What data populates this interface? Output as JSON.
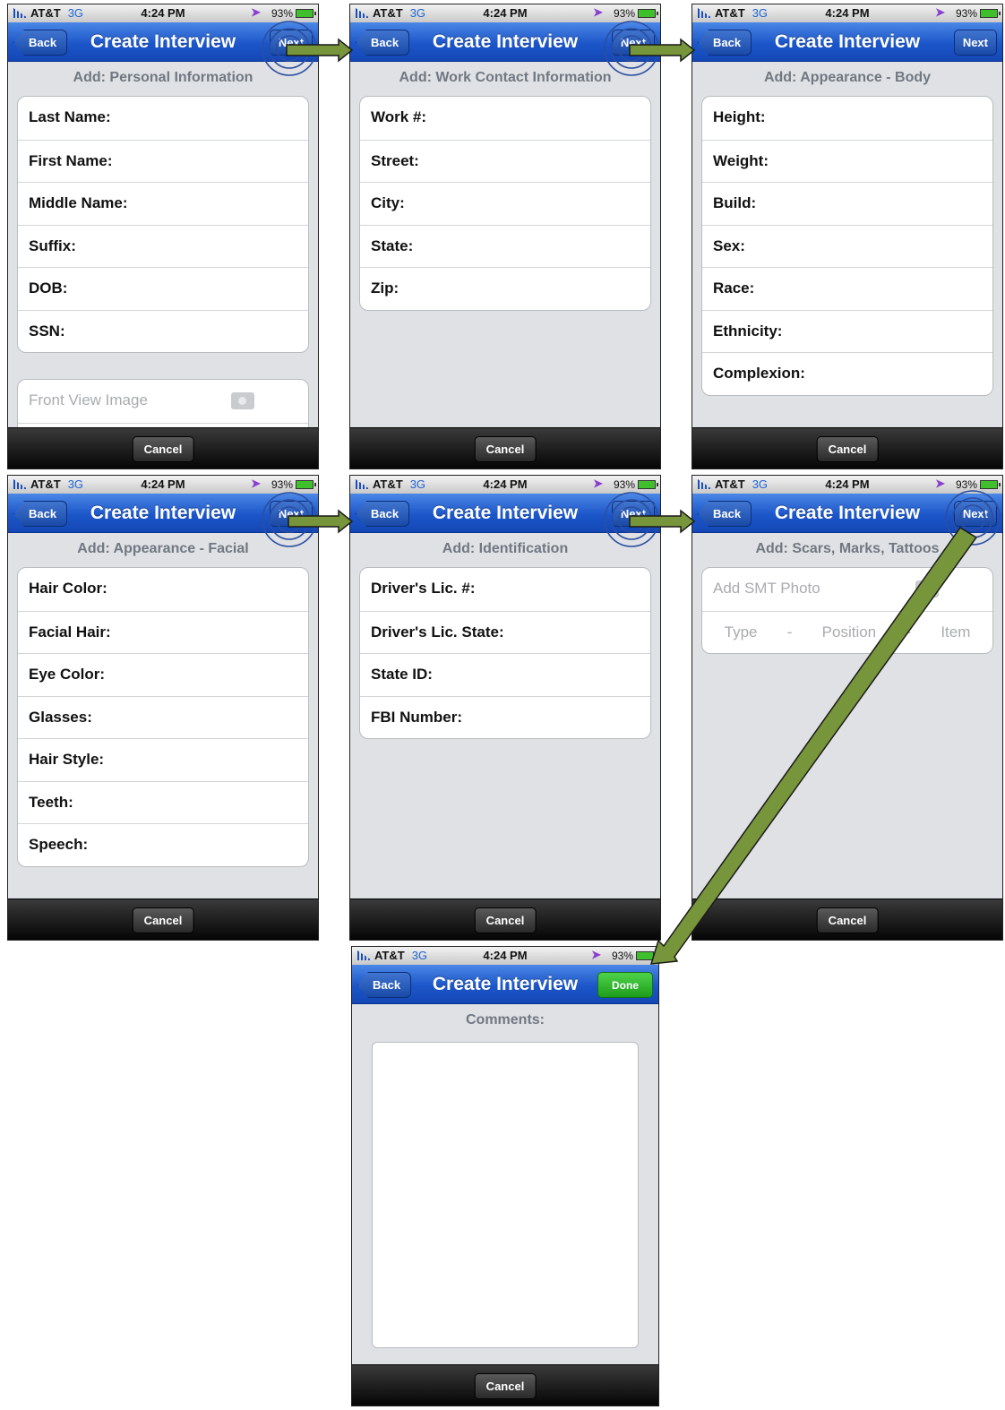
{
  "status": {
    "carrier": "AT&T",
    "network": "3G",
    "time": "4:24 PM",
    "battery": "93%",
    "location_icon": "location-arrow-icon"
  },
  "nav": {
    "title": "Create Interview",
    "back_label": "Back",
    "next_label": "Next",
    "done_label": "Done"
  },
  "toolbar": {
    "cancel_label": "Cancel"
  },
  "screens": [
    {
      "section": "Add: Personal Information",
      "rows": [
        "Last Name:",
        "First Name:",
        "Middle Name:",
        "Suffix:",
        "DOB:",
        "SSN:"
      ],
      "photo_placeholder": "Front View Image"
    },
    {
      "section": "Add: Work Contact Information",
      "rows": [
        "Work #:",
        "Street:",
        "City:",
        "State:",
        "Zip:"
      ]
    },
    {
      "section": "Add: Appearance - Body",
      "rows": [
        "Height:",
        "Weight:",
        "Build:",
        "Sex:",
        "Race:",
        "Ethnicity:",
        "Complexion:"
      ]
    },
    {
      "section": "Add: Appearance - Facial",
      "rows": [
        "Hair Color:",
        "Facial Hair:",
        "Eye Color:",
        "Glasses:",
        "Hair Style:",
        "Teeth:",
        "Speech:"
      ]
    },
    {
      "section": "Add: Identification",
      "rows": [
        "Driver's Lic. #:",
        "Driver's Lic. State:",
        "State ID:",
        "FBI Number:"
      ]
    },
    {
      "section": "Add: Scars, Marks, Tattoos",
      "photo_placeholder": "Add SMT Photo",
      "picker": [
        "Type",
        "-",
        "Position",
        "-",
        "Item"
      ]
    },
    {
      "section": "Comments:"
    }
  ],
  "colors": {
    "nav_blue": "#1c56c9",
    "arrow_green": "#77953a",
    "done_green": "#2aa826",
    "highlight_ring": "#2b4ea0"
  }
}
